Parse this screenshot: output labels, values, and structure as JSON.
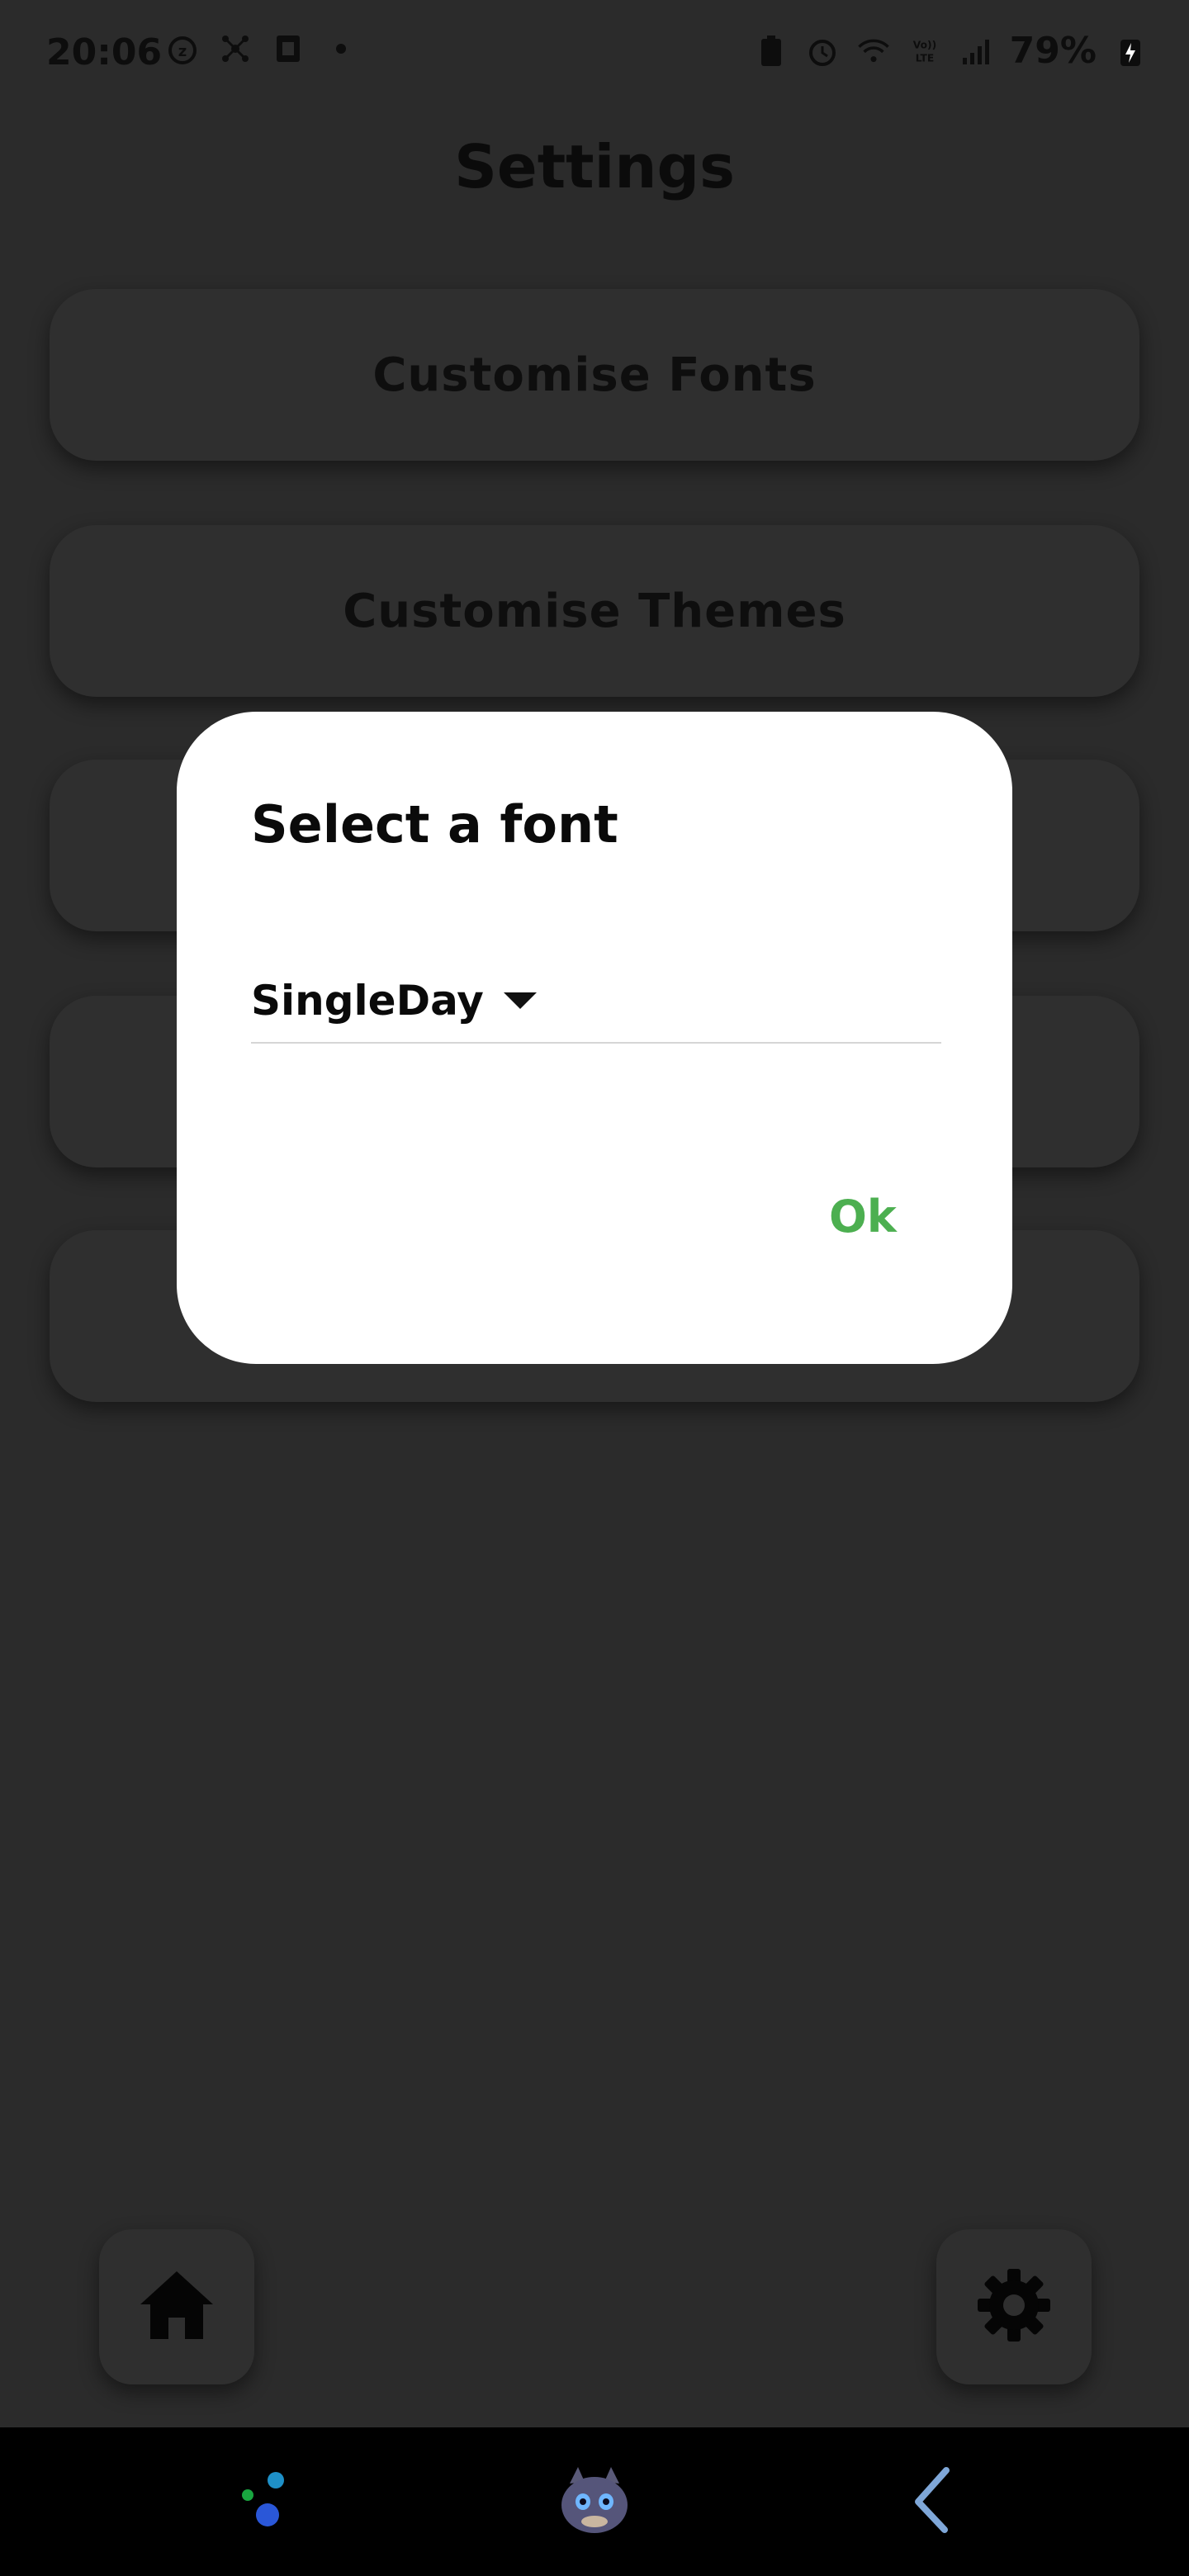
{
  "status_bar": {
    "time": "20:06",
    "battery": "79%",
    "left_icons": [
      "snooze-alarm-icon",
      "network-icon",
      "sim-icon",
      "dot-icon"
    ],
    "right_icons": [
      "battery-saver-icon",
      "alarm-icon",
      "wifi-icon",
      "volte-icon",
      "signal-icon",
      "charging-icon"
    ]
  },
  "page": {
    "title": "Settings"
  },
  "settings": {
    "items": [
      {
        "label": "Customise Fonts"
      },
      {
        "label": "Customise Themes"
      },
      {
        "label": ""
      },
      {
        "label": ""
      },
      {
        "label": ""
      }
    ]
  },
  "dialog": {
    "title": "Select a font",
    "selected_font": "SingleDay",
    "ok_label": "Ok",
    "ok_color": "#4caf50"
  },
  "bottom_buttons": {
    "home_icon": "home-icon",
    "settings_icon": "gear-icon"
  },
  "nav_bar": {
    "items": [
      "dots-app-icon",
      "dragon-avatar-icon",
      "back-arrow-icon"
    ]
  }
}
